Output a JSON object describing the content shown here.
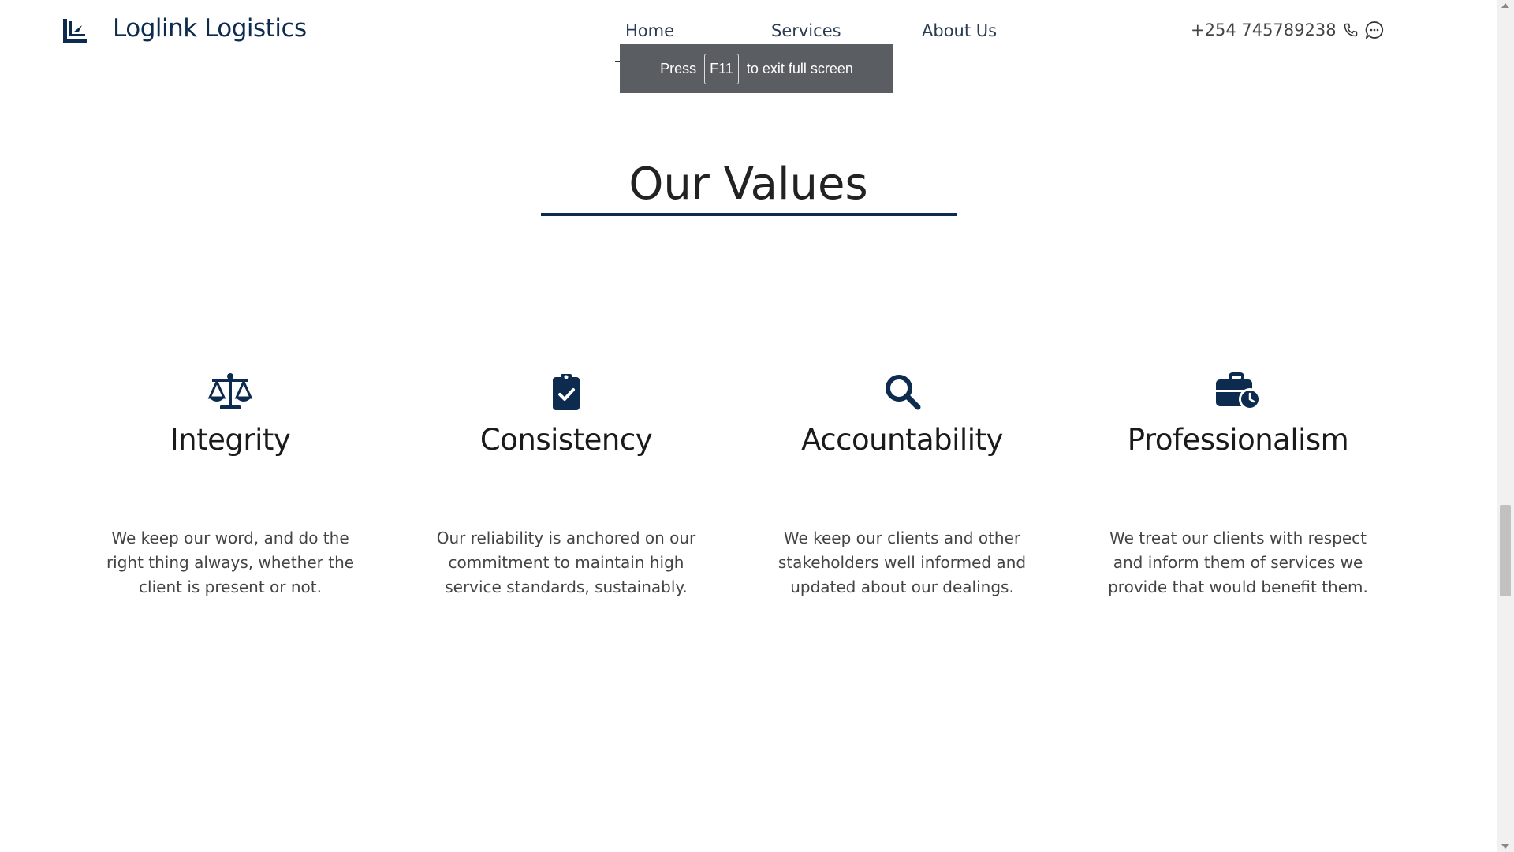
{
  "header": {
    "brand": "Loglink Logistics",
    "nav": [
      {
        "label": "Home",
        "active": true
      },
      {
        "label": "Services",
        "active": false
      },
      {
        "label": "About Us",
        "active": false
      }
    ],
    "phone": "+254 745789238",
    "phone_icon": "phone-icon",
    "chat_icon": "chat-icon"
  },
  "fullscreen_notice": {
    "prefix": "Press",
    "key": "F11",
    "suffix": "to exit full screen"
  },
  "values_section": {
    "title": "Our Values",
    "items": [
      {
        "icon": "scales-icon",
        "title": "Integrity",
        "text": "We keep our word, and do the right thing always, whether the client is present or not."
      },
      {
        "icon": "clipboard-check-icon",
        "title": "Consistency",
        "text": "Our reliability is anchored on our commitment to maintain high service standards, sustainably."
      },
      {
        "icon": "search-icon",
        "title": "Accountability",
        "text": "We keep our clients and other stakeholders well informed and updated about our dealings."
      },
      {
        "icon": "briefcase-clock-icon",
        "title": "Professionalism",
        "text": "We treat our clients with respect and inform them of services we provide that would benefit them."
      }
    ]
  },
  "colors": {
    "brand_navy": "#0d2b4e",
    "notice_bg": "#5a5d61"
  }
}
